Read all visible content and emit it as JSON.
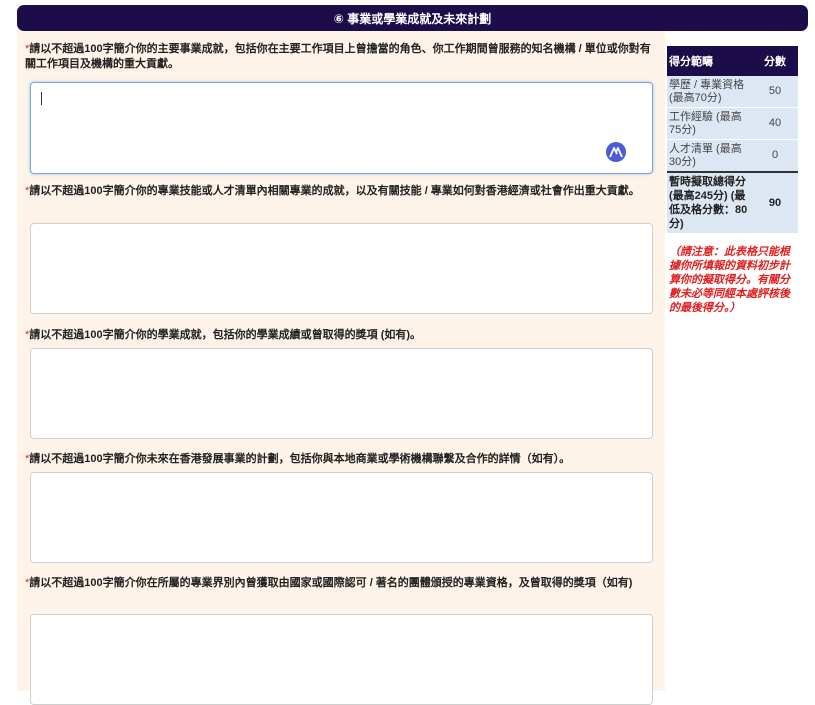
{
  "section": {
    "title": "⑥ 事業或學業成就及未來計劃"
  },
  "questions": [
    {
      "required": "*",
      "label": "請以不超過100字簡介你的主要事業成就，包括你在主要工作項目上曾擔當的角色、你工作期間曾服務的知名機構 / 單位或你對有關工作項目及機構的重大貢獻。"
    },
    {
      "required": "*",
      "label": "請以不超過100字簡介你的專業技能或人才清單內相關專業的成就，以及有關技能 / 專業如何對香港經濟或社會作出重大貢獻。"
    },
    {
      "required": "*",
      "label": "請以不超過100字簡介你的學業成就，包括你的學業成績或曾取得的獎項 (如有)。"
    },
    {
      "required": "*",
      "label": "請以不超過100字簡介你未來在香港發展事業的計劃，包括你與本地商業或學術機構聯繫及合作的詳情（如有）。"
    },
    {
      "required": "*",
      "label": "請以不超過100字簡介你在所屬的專業界別內曾獲取由國家或國際認可 / 著名的團體頒授的專業資格，及曾取得的獎項（如有)"
    }
  ],
  "score_table": {
    "headers": {
      "category": "得分範疇",
      "score": "分數"
    },
    "rows": [
      {
        "label": "學歷 / 專業資格 (最高70分)",
        "value": "50"
      },
      {
        "label": "工作經驗 (最高75分)",
        "value": "40"
      },
      {
        "label": "人才清單 (最高30分)",
        "value": "0"
      }
    ],
    "total": {
      "label": "暫時擬取總得分 (最高245分) (最低及格分數：80分)",
      "value": "90"
    },
    "note": "（請注意：此表格只能根據你所填報的資料初步計算你的擬取得分。有關分數未必等同經本處評核後的最後得分。）"
  },
  "icons": {
    "assistant": "grammar-assistant-icon"
  },
  "colors": {
    "header_bg": "#1c0d4a",
    "form_bg": "#fdf3e9",
    "table_cell_bg": "#dde7f4",
    "note": "#e02020"
  }
}
